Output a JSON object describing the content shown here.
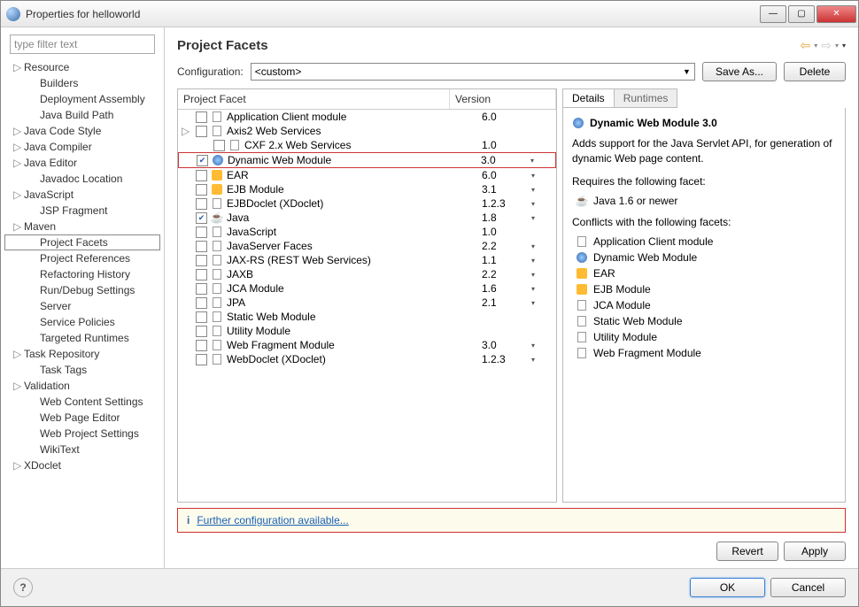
{
  "window": {
    "title": "Properties for helloworld"
  },
  "filter_placeholder": "type filter text",
  "sidebar": [
    {
      "label": "Resource",
      "exp": "▷"
    },
    {
      "label": "Builders",
      "exp": "",
      "child": true
    },
    {
      "label": "Deployment Assembly",
      "exp": "",
      "child": true
    },
    {
      "label": "Java Build Path",
      "exp": "",
      "child": true
    },
    {
      "label": "Java Code Style",
      "exp": "▷"
    },
    {
      "label": "Java Compiler",
      "exp": "▷"
    },
    {
      "label": "Java Editor",
      "exp": "▷"
    },
    {
      "label": "Javadoc Location",
      "exp": "",
      "child": true
    },
    {
      "label": "JavaScript",
      "exp": "▷"
    },
    {
      "label": "JSP Fragment",
      "exp": "",
      "child": true
    },
    {
      "label": "Maven",
      "exp": "▷"
    },
    {
      "label": "Project Facets",
      "exp": "",
      "child": true,
      "selected": true
    },
    {
      "label": "Project References",
      "exp": "",
      "child": true
    },
    {
      "label": "Refactoring History",
      "exp": "",
      "child": true
    },
    {
      "label": "Run/Debug Settings",
      "exp": "",
      "child": true
    },
    {
      "label": "Server",
      "exp": "",
      "child": true
    },
    {
      "label": "Service Policies",
      "exp": "",
      "child": true
    },
    {
      "label": "Targeted Runtimes",
      "exp": "",
      "child": true
    },
    {
      "label": "Task Repository",
      "exp": "▷"
    },
    {
      "label": "Task Tags",
      "exp": "",
      "child": true
    },
    {
      "label": "Validation",
      "exp": "▷"
    },
    {
      "label": "Web Content Settings",
      "exp": "",
      "child": true
    },
    {
      "label": "Web Page Editor",
      "exp": "",
      "child": true
    },
    {
      "label": "Web Project Settings",
      "exp": "",
      "child": true
    },
    {
      "label": "WikiText",
      "exp": "",
      "child": true
    },
    {
      "label": "XDoclet",
      "exp": "▷"
    }
  ],
  "main": {
    "title": "Project Facets",
    "config_label": "Configuration:",
    "config_value": "<custom>",
    "save_as": "Save As...",
    "delete": "Delete",
    "col_facet": "Project Facet",
    "col_version": "Version",
    "revert": "Revert",
    "apply": "Apply",
    "info_link": "Further configuration available..."
  },
  "facets": [
    {
      "exp": "",
      "chk": false,
      "icon": "doc",
      "name": "Application Client module",
      "ver": "6.0",
      "dd": false
    },
    {
      "exp": "▷",
      "chk": false,
      "icon": "doc",
      "name": "Axis2 Web Services",
      "ver": "",
      "dd": false
    },
    {
      "exp": "",
      "chk": false,
      "icon": "doc",
      "name": "CXF 2.x Web Services",
      "ver": "1.0",
      "dd": false,
      "indent": true
    },
    {
      "exp": "",
      "chk": true,
      "icon": "globe",
      "name": "Dynamic Web Module",
      "ver": "3.0",
      "dd": true,
      "highlight": true
    },
    {
      "exp": "",
      "chk": false,
      "icon": "jar",
      "name": "EAR",
      "ver": "6.0",
      "dd": true
    },
    {
      "exp": "",
      "chk": false,
      "icon": "jar",
      "name": "EJB Module",
      "ver": "3.1",
      "dd": true
    },
    {
      "exp": "",
      "chk": false,
      "icon": "doc",
      "name": "EJBDoclet (XDoclet)",
      "ver": "1.2.3",
      "dd": true
    },
    {
      "exp": "",
      "chk": true,
      "icon": "cup",
      "name": "Java",
      "ver": "1.8",
      "dd": true
    },
    {
      "exp": "",
      "chk": false,
      "icon": "doc",
      "name": "JavaScript",
      "ver": "1.0",
      "dd": false
    },
    {
      "exp": "",
      "chk": false,
      "icon": "doc",
      "name": "JavaServer Faces",
      "ver": "2.2",
      "dd": true
    },
    {
      "exp": "",
      "chk": false,
      "icon": "doc",
      "name": "JAX-RS (REST Web Services)",
      "ver": "1.1",
      "dd": true
    },
    {
      "exp": "",
      "chk": false,
      "icon": "doc",
      "name": "JAXB",
      "ver": "2.2",
      "dd": true
    },
    {
      "exp": "",
      "chk": false,
      "icon": "doc",
      "name": "JCA Module",
      "ver": "1.6",
      "dd": true
    },
    {
      "exp": "",
      "chk": false,
      "icon": "doc",
      "name": "JPA",
      "ver": "2.1",
      "dd": true
    },
    {
      "exp": "",
      "chk": false,
      "icon": "doc",
      "name": "Static Web Module",
      "ver": "",
      "dd": false
    },
    {
      "exp": "",
      "chk": false,
      "icon": "doc",
      "name": "Utility Module",
      "ver": "",
      "dd": false
    },
    {
      "exp": "",
      "chk": false,
      "icon": "doc",
      "name": "Web Fragment Module",
      "ver": "3.0",
      "dd": true
    },
    {
      "exp": "",
      "chk": false,
      "icon": "doc",
      "name": "WebDoclet (XDoclet)",
      "ver": "1.2.3",
      "dd": true
    }
  ],
  "detail": {
    "tab_details": "Details",
    "tab_runtimes": "Runtimes",
    "title": "Dynamic Web Module 3.0",
    "desc": "Adds support for the Java Servlet API, for generation of dynamic Web page content.",
    "requires_label": "Requires the following facet:",
    "requires": [
      {
        "icon": "cup",
        "label": "Java 1.6 or newer"
      }
    ],
    "conflicts_label": "Conflicts with the following facets:",
    "conflicts": [
      {
        "icon": "doc",
        "label": "Application Client module"
      },
      {
        "icon": "globe",
        "label": "Dynamic Web Module"
      },
      {
        "icon": "jar",
        "label": "EAR"
      },
      {
        "icon": "jar",
        "label": "EJB Module"
      },
      {
        "icon": "doc",
        "label": "JCA Module"
      },
      {
        "icon": "doc",
        "label": "Static Web Module"
      },
      {
        "icon": "doc",
        "label": "Utility Module"
      },
      {
        "icon": "doc",
        "label": "Web Fragment Module"
      }
    ]
  },
  "footer": {
    "ok": "OK",
    "cancel": "Cancel"
  }
}
